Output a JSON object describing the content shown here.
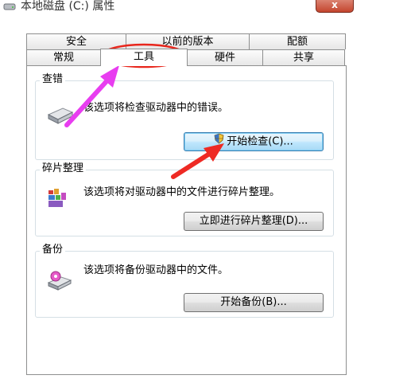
{
  "window": {
    "title": "本地磁盘 (C:) 属性",
    "close_label": "x"
  },
  "tabs": {
    "back_row": [
      "安全",
      "以前的版本",
      "配额"
    ],
    "front_row": [
      "常规",
      "工具",
      "硬件",
      "共享"
    ],
    "active": "工具"
  },
  "groups": {
    "error_check": {
      "title": "查错",
      "description": "该选项将检查驱动器中的错误。",
      "button": "开始检查(C)..."
    },
    "defrag": {
      "title": "碎片整理",
      "description": "该选项将对驱动器中的文件进行碎片整理。",
      "button": "立即进行碎片整理(D)..."
    },
    "backup": {
      "title": "备份",
      "description": "该选项将备份驱动器中的文件。",
      "button": "开始备份(B)..."
    }
  },
  "annotations": {
    "arrow_color": "#e83df0",
    "arrow2_color": "#ee2a24",
    "circle_color": "#e8261c"
  }
}
